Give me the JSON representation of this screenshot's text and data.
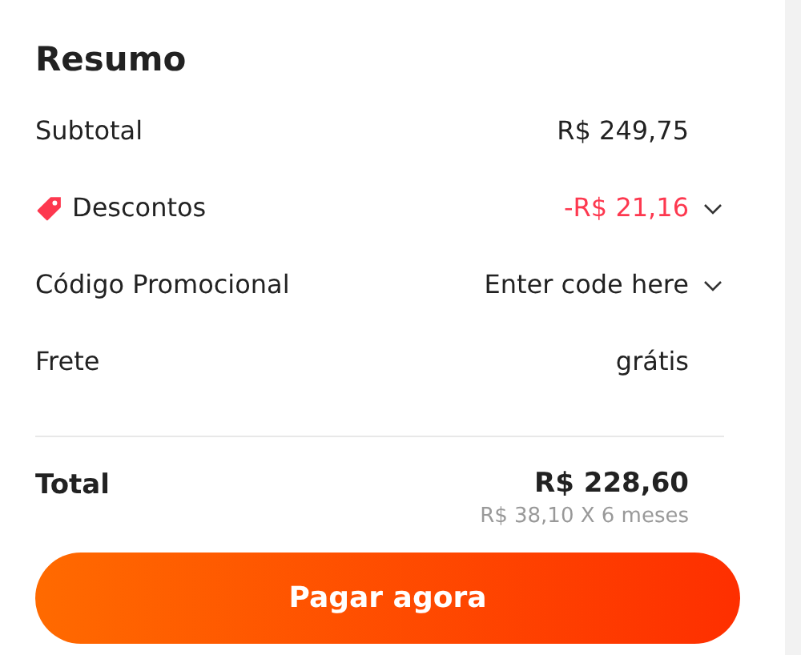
{
  "title": "Resumo",
  "rows": [
    {
      "kind": "plain",
      "label": "Subtotal",
      "value": "R$ 249,75"
    },
    {
      "kind": "discount",
      "label": "Descontos",
      "value": "-R$ 21,16",
      "expanded": false
    },
    {
      "kind": "promo",
      "label": "Código Promocional",
      "value": "Enter code here",
      "expanded": false
    },
    {
      "kind": "plain",
      "label": "Frete",
      "value": "grátis"
    }
  ],
  "total": {
    "label": "Total",
    "value": "R$ 228,60",
    "installments": "R$ 38,10 X 6 meses"
  },
  "button": "Pagar agora"
}
